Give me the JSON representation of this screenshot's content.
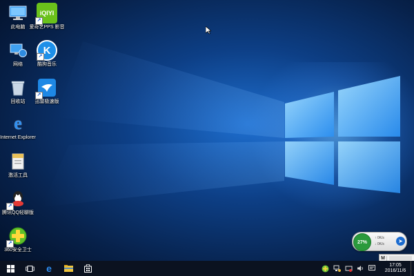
{
  "desktop_icons": [
    {
      "key": "this-pc",
      "label": "此电脑",
      "icon": "computer-icon",
      "shortcut": false
    },
    {
      "key": "iqiyi",
      "label": "爱奇艺PPS 影音",
      "icon": "iqiyi-icon",
      "icon_text": "iQIYI",
      "shortcut": true
    },
    {
      "key": "network",
      "label": "网络",
      "icon": "network-icon",
      "shortcut": false
    },
    {
      "key": "kugou",
      "label": "酷狗音乐",
      "icon": "kugou-icon",
      "icon_text": "K",
      "shortcut": true
    },
    {
      "key": "recycle-bin",
      "label": "回收站",
      "icon": "recycle-bin-icon",
      "shortcut": false
    },
    {
      "key": "xunlei",
      "label": "迅雷极速版",
      "icon": "xunlei-icon",
      "shortcut": true
    },
    {
      "key": "ie",
      "label": "Internet Explorer",
      "icon": "internet-explorer-icon",
      "icon_text": "e",
      "shortcut": false
    },
    {
      "key": "activator",
      "label": "激活工具",
      "icon": "activation-tool-icon",
      "shortcut": false
    },
    {
      "key": "qq",
      "label": "腾讯QQ轻聊版",
      "icon": "qq-icon",
      "shortcut": true
    },
    {
      "key": "360",
      "label": "360安全卫士",
      "icon": "360-safe-icon",
      "shortcut": true
    }
  ],
  "net_monitor": {
    "percent": "27%",
    "upload": "0K/s",
    "download": "0K/s",
    "color_ok": "#2a9a3c"
  },
  "ime": {
    "mode": "M"
  },
  "taskbar": {
    "buttons": [
      "start-icon",
      "task-view-icon",
      "edge-icon",
      "file-explorer-icon",
      "store-icon"
    ],
    "tray": [
      "360-tray-icon",
      "network-status-icon",
      "volume-icon",
      "speaker-icon",
      "action-center-icon"
    ],
    "time": "17:05",
    "date": "2016/11/6"
  },
  "colors": {
    "accent": "#1e6fd0",
    "taskbar": "#0b1220"
  }
}
